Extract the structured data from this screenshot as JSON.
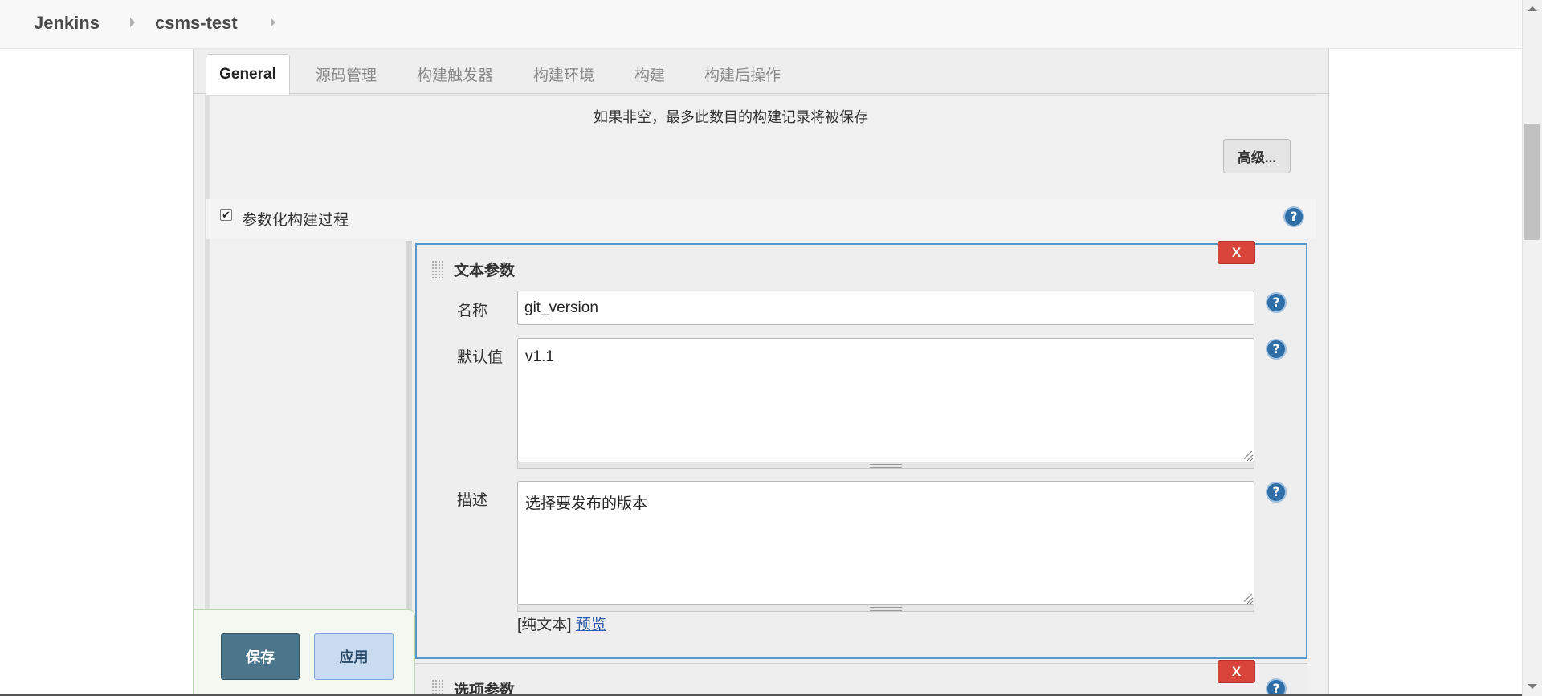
{
  "breadcrumb": {
    "root": "Jenkins",
    "job": "csms-test"
  },
  "tabs": [
    {
      "label": "General",
      "active": true
    },
    {
      "label": "源码管理"
    },
    {
      "label": "构建触发器"
    },
    {
      "label": "构建环境"
    },
    {
      "label": "构建"
    },
    {
      "label": "构建后操作"
    }
  ],
  "general": {
    "build_record_note": "如果非空，最多此数目的构建记录将被保存",
    "advanced_button": "高级...",
    "parameterized_label": "参数化构建过程",
    "parameterized_checked": true
  },
  "text_param": {
    "title": "文本参数",
    "delete_label": "X",
    "name_label": "名称",
    "name_value": "git_version",
    "default_label": "默认值",
    "default_value": "v1.1",
    "description_label": "描述",
    "description_value": "选择要发布的版本",
    "plain_text": "[纯文本]",
    "preview": "预览"
  },
  "choice_param": {
    "title": "选项参数",
    "delete_label": "X"
  },
  "actions": {
    "save": "保存",
    "apply": "应用"
  },
  "help_glyph": "?",
  "colors": {
    "delete_button": "#d9443a",
    "save_button": "#4b758b",
    "apply_button": "#c8dbef",
    "help_icon": "#2f6ea7",
    "block_border": "#5b96c8"
  }
}
